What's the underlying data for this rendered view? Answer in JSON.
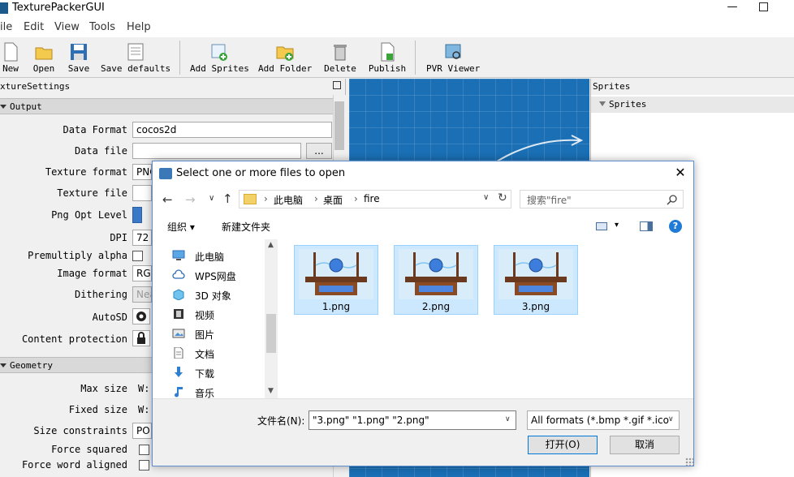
{
  "app": {
    "title": "TexturePackerGUI",
    "min_glyph": "—",
    "menus": [
      "ile",
      "Edit",
      "View",
      "Tools",
      "Help"
    ]
  },
  "toolbar": {
    "buttons": [
      {
        "label": "New",
        "icon": "new-file-icon"
      },
      {
        "label": "Open",
        "icon": "open-folder-icon"
      },
      {
        "label": "Save",
        "icon": "floppy-icon"
      },
      {
        "label": "Save defaults",
        "icon": "save-defaults-icon"
      },
      {
        "label": "Add Sprites",
        "icon": "add-sprites-icon"
      },
      {
        "label": "Add Folder",
        "icon": "add-folder-icon"
      },
      {
        "label": "Delete",
        "icon": "trash-icon"
      },
      {
        "label": "Publish",
        "icon": "publish-icon"
      },
      {
        "label": "PVR Viewer",
        "icon": "pvr-viewer-icon"
      }
    ]
  },
  "settings": {
    "header": "xtureSettings",
    "output_section": "Output",
    "geometry_section": "Geometry",
    "props": [
      {
        "label": "Data Format",
        "value": "cocos2d"
      },
      {
        "label": "Data file",
        "value": ""
      },
      {
        "label": "Texture format",
        "value": "PNG"
      },
      {
        "label": "Texture file",
        "value": ""
      },
      {
        "label": "Png Opt Level",
        "value": ""
      },
      {
        "label": "DPI",
        "value": "72"
      },
      {
        "label": "Premultiply alpha",
        "value": ""
      },
      {
        "label": "Image format",
        "value": "RGB"
      },
      {
        "label": "Dithering",
        "value": "Nea"
      },
      {
        "label": "AutoSD",
        "value": ""
      },
      {
        "label": "Content protection",
        "value": ""
      }
    ],
    "geometry_props": [
      {
        "label": "Max size",
        "value": "W:"
      },
      {
        "label": "Fixed size",
        "value": "W:"
      },
      {
        "label": "Size constraints",
        "value": "PO"
      },
      {
        "label": "Force squared",
        "value": ""
      },
      {
        "label": "Force word aligned",
        "value": ""
      }
    ],
    "browse_label": "..."
  },
  "sprites": {
    "header": "Sprites",
    "group": "Sprites"
  },
  "dialog": {
    "title": "Select one or more files to open",
    "close_glyph": "✕",
    "back_glyph": "←",
    "fwd_glyph": "→",
    "recent_glyph": "∨",
    "up_glyph": "↑",
    "refresh_glyph": "↻",
    "dropdown_glyph": "∨",
    "crumb_sep": "›",
    "breadcrumbs": [
      "此电脑",
      "桌面",
      "fire"
    ],
    "search_placeholder": "搜索\"fire\"",
    "organize": "组织 ▾",
    "new_folder": "新建文件夹",
    "help_glyph": "?",
    "view_drop": "▾",
    "nav_scroll_up": "▲",
    "nav_scroll_down": "▼",
    "nav_items": [
      {
        "label": "此电脑",
        "icon": "computer-icon"
      },
      {
        "label": "WPS网盘",
        "icon": "cloud-icon"
      },
      {
        "label": "3D 对象",
        "icon": "3d-objects-icon"
      },
      {
        "label": "视频",
        "icon": "video-icon"
      },
      {
        "label": "图片",
        "icon": "pictures-icon"
      },
      {
        "label": "文档",
        "icon": "documents-icon"
      },
      {
        "label": "下载",
        "icon": "download-icon"
      },
      {
        "label": "音乐",
        "icon": "music-icon"
      }
    ],
    "files": [
      "1.png",
      "2.png",
      "3.png"
    ],
    "filename_label": "文件名(N):",
    "filename_value": "\"3.png\" \"1.png\" \"2.png\"",
    "filetype_value": "All formats (*.bmp *.gif *.ico",
    "open_label": "打开(O)",
    "cancel_label": "取消"
  },
  "colors": {
    "canvas": "#1a6fb5",
    "selection": "#cce8ff",
    "accent": "#0078d7"
  }
}
